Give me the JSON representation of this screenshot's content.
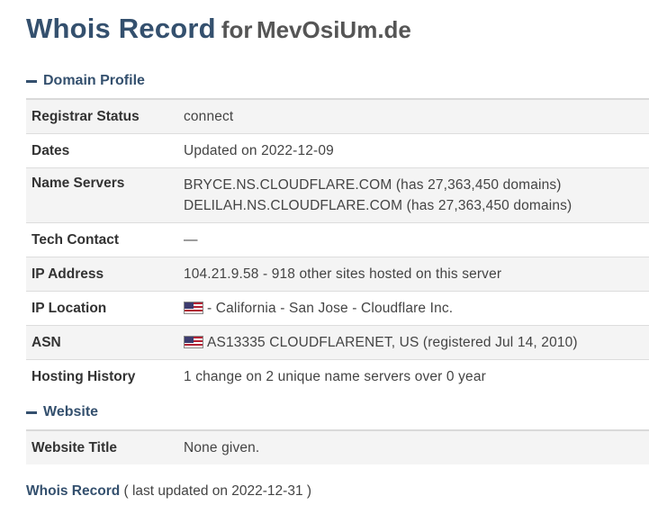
{
  "header": {
    "title": "Whois Record",
    "for_text": "for",
    "domain": "MevOsiUm.de"
  },
  "sections": {
    "domain_profile": {
      "title": "Domain Profile",
      "rows": {
        "registrar_status": {
          "label": "Registrar Status",
          "value": "connect"
        },
        "dates": {
          "label": "Dates",
          "value": "Updated on 2022-12-09"
        },
        "name_servers": {
          "label": "Name Servers",
          "value_1": "BRYCE.NS.CLOUDFLARE.COM (has 27,363,450 domains)",
          "value_2": "DELILAH.NS.CLOUDFLARE.COM (has 27,363,450 domains)"
        },
        "tech_contact": {
          "label": "Tech Contact",
          "value": "—"
        },
        "ip_address": {
          "label": "IP Address",
          "value": "104.21.9.58 - 918 other sites hosted on this server"
        },
        "ip_location": {
          "label": "IP Location",
          "value": "- California - San Jose - Cloudflare Inc.",
          "icon": "us-flag-icon"
        },
        "asn": {
          "label": "ASN",
          "value": "AS13335 CLOUDFLARENET, US (registered Jul 14, 2010)",
          "icon": "us-flag-icon"
        },
        "hosting_history": {
          "label": "Hosting History",
          "value": "1 change on 2 unique name servers over 0 year"
        }
      }
    },
    "website": {
      "title": "Website",
      "rows": {
        "website_title": {
          "label": "Website Title",
          "value": "None given."
        }
      }
    }
  },
  "footer": {
    "link": "Whois Record",
    "updated": "( last updated on 2022-12-31 )"
  },
  "colors": {
    "accent": "#34506e",
    "row_shade": "#f4f4f4"
  }
}
